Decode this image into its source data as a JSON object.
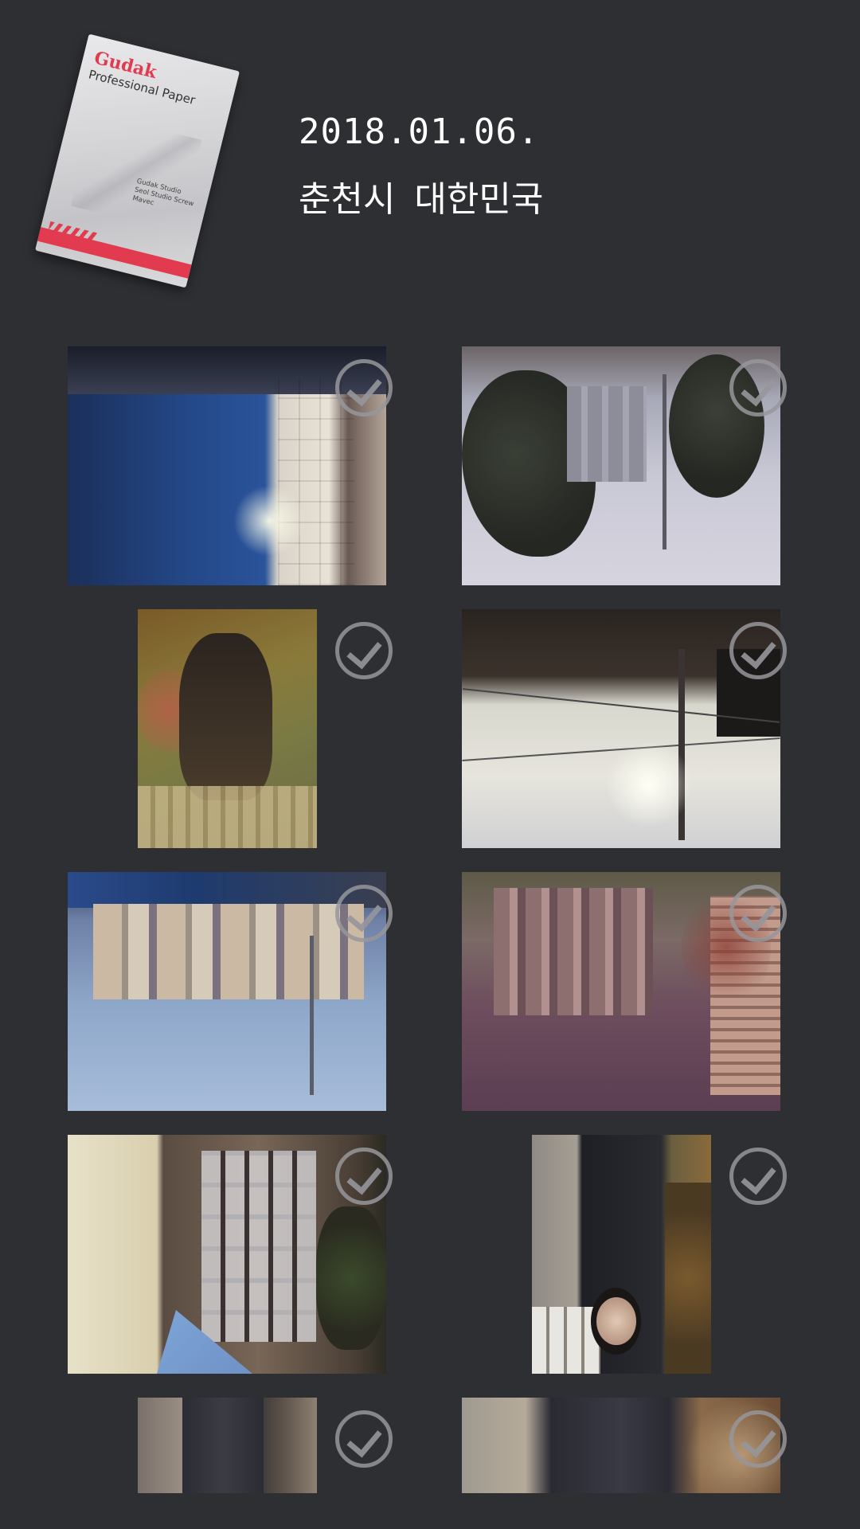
{
  "header": {
    "film_pack": {
      "brand": "Gudak",
      "subtitle": "Professional Paper",
      "fine_print": "Gudak Studio Seol Studio Screw Mavec"
    },
    "date": "2018.01.06.",
    "location": "춘천시 대한민국"
  },
  "photos": [
    {
      "name": "photo-1",
      "selected": true
    },
    {
      "name": "photo-2",
      "selected": true
    },
    {
      "name": "photo-3",
      "selected": true
    },
    {
      "name": "photo-4",
      "selected": true
    },
    {
      "name": "photo-5",
      "selected": true
    },
    {
      "name": "photo-6",
      "selected": true
    },
    {
      "name": "photo-7",
      "selected": true
    },
    {
      "name": "photo-8",
      "selected": true
    },
    {
      "name": "photo-9",
      "selected": true
    },
    {
      "name": "photo-10",
      "selected": true
    }
  ],
  "colors": {
    "background": "#2e2f33",
    "check": "#96969b",
    "brand_red": "#e23a4e",
    "text": "#ffffff"
  }
}
